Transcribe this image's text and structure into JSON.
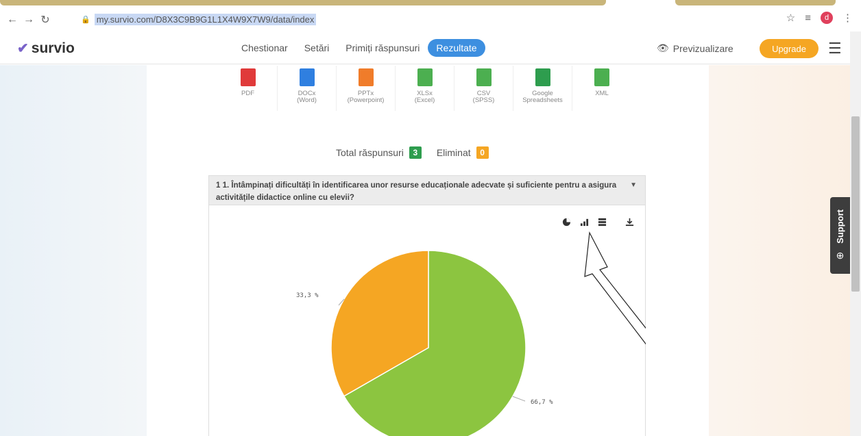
{
  "browser": {
    "url": "my.survio.com/D8X3C9B9G1L1X4W9X7W9/data/index",
    "profile_initial": "d"
  },
  "app": {
    "logo": "survio",
    "tabs": [
      {
        "label": "Chestionar"
      },
      {
        "label": "Setări"
      },
      {
        "label": "Primiți răspunsuri"
      },
      {
        "label": "Rezultate"
      }
    ],
    "preview_label": "Previzualizare",
    "upgrade_label": "Upgrade"
  },
  "exports": [
    {
      "label": "PDF",
      "sub": "",
      "color": "#e03a3a",
      "icon": "pdf-icon"
    },
    {
      "label": "DOCx",
      "sub": "(Word)",
      "color": "#2f7fe0",
      "icon": "docx-icon"
    },
    {
      "label": "PPTx",
      "sub": "(Powerpoint)",
      "color": "#f07c2a",
      "icon": "pptx-icon"
    },
    {
      "label": "XLSx",
      "sub": "(Excel)",
      "color": "#4caf50",
      "icon": "xlsx-icon"
    },
    {
      "label": "CSV",
      "sub": "(SPSS)",
      "color": "#4caf50",
      "icon": "csv-icon"
    },
    {
      "label": "Google",
      "sub": "Spreadsheets",
      "color": "#2e9d4e",
      "icon": "sheets-icon"
    },
    {
      "label": "XML",
      "sub": "",
      "color": "#4caf50",
      "icon": "xml-icon"
    }
  ],
  "totals": {
    "total_label": "Total răspunsuri",
    "total_value": "3",
    "eliminated_label": "Eliminat",
    "eliminated_value": "0",
    "total_color": "#2e9d4e",
    "eliminated_color": "#f5a623"
  },
  "question": {
    "title": "1 1. Întâmpinați dificultăți în identificarea unor resurse educaționale adecvate și suficiente pentru a asigura activitățile didactice online cu elevii?"
  },
  "support_label": "Support",
  "chart_data": {
    "type": "pie",
    "values": [
      66.7,
      33.3
    ],
    "labels": [
      "66,7 %",
      "33,3 %"
    ],
    "colors": [
      "#8cc540",
      "#f5a623"
    ]
  }
}
